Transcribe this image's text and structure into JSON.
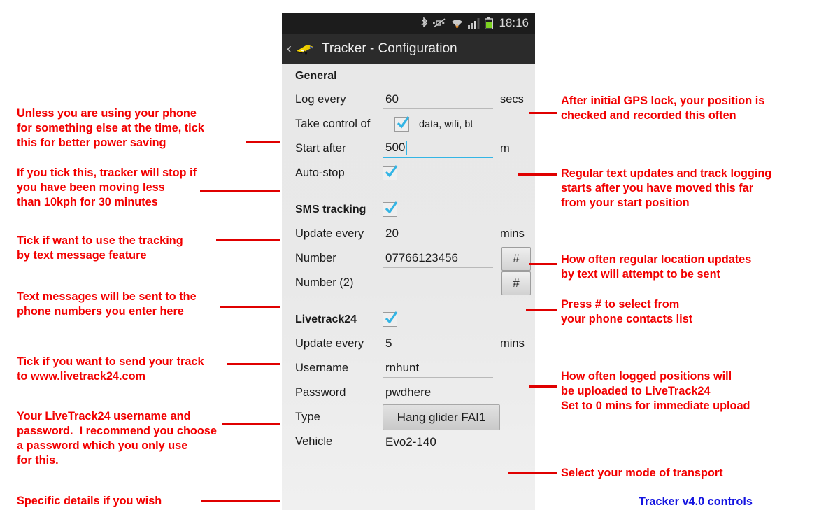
{
  "phone": {
    "statusbar": {
      "time": "18:16",
      "icons": [
        "bluetooth-icon",
        "vibrate-muted-icon",
        "wifi-download-icon",
        "signal-bars-icon",
        "battery-icon"
      ]
    },
    "titlebar": {
      "back_label": "‹",
      "app_icon": "hang-glider-icon",
      "title": "Tracker - Configuration"
    },
    "sections": [
      {
        "heading": "General",
        "rows": [
          {
            "label": "Log every",
            "value": "60",
            "unit": "secs"
          },
          {
            "label": "Take control of",
            "checkbox": true,
            "note": "data, wifi, bt"
          },
          {
            "label": "Start after",
            "value": "500",
            "unit": "m",
            "focused": true
          },
          {
            "label": "Auto-stop",
            "checkbox": true
          }
        ]
      },
      {
        "heading": "SMS tracking",
        "heading_checkbox": true,
        "rows": [
          {
            "label": "Update every",
            "value": "20",
            "unit": "mins"
          },
          {
            "label": "Number",
            "value": "07766123456",
            "button": "#"
          },
          {
            "label": "Number (2)",
            "value": "",
            "button": "#"
          }
        ]
      },
      {
        "heading": "Livetrack24",
        "heading_checkbox": true,
        "rows": [
          {
            "label": "Update every",
            "value": "5",
            "unit": "mins"
          },
          {
            "label": "Username",
            "value": "rnhunt"
          },
          {
            "label": "Password",
            "value": "pwdhere"
          },
          {
            "label": "Type",
            "dropdown": "Hang glider FAI1"
          },
          {
            "label": "Vehicle",
            "plain": "Evo2-140"
          }
        ]
      }
    ]
  },
  "annotations": {
    "left": [
      "Unless you are using your phone\nfor something else at the time, tick\nthis for better power saving",
      "If you tick this, tracker will stop if\nyou have been moving less\nthan 10kph for 30 minutes",
      "Tick if want to use the tracking\nby text message feature",
      "Text messages will be sent to the\nphone numbers you enter here",
      "Tick if you want to send your track\nto www.livetrack24.com",
      "Your LiveTrack24 username and\npassword.  I recommend you choose\na password which you only use\nfor this.",
      "Specific details if you wish"
    ],
    "right": [
      "After initial GPS lock, your position is\nchecked and recorded this often",
      "Regular text updates and track logging\nstarts after you have moved this far\nfrom your start position",
      "How often regular location updates\nby text will attempt to be sent",
      "Press # to select from\nyour phone contacts list",
      "How often logged positions will\nbe uploaded to LiveTrack24\nSet to 0 mins for immediate upload",
      "Select your mode of transport"
    ],
    "footer": "Tracker v4.0 controls"
  },
  "colors": {
    "annotation_red": "#f20000",
    "leader_red": "#e00000",
    "footer_blue": "#1414e0",
    "accent_blue": "#33b5e5"
  }
}
